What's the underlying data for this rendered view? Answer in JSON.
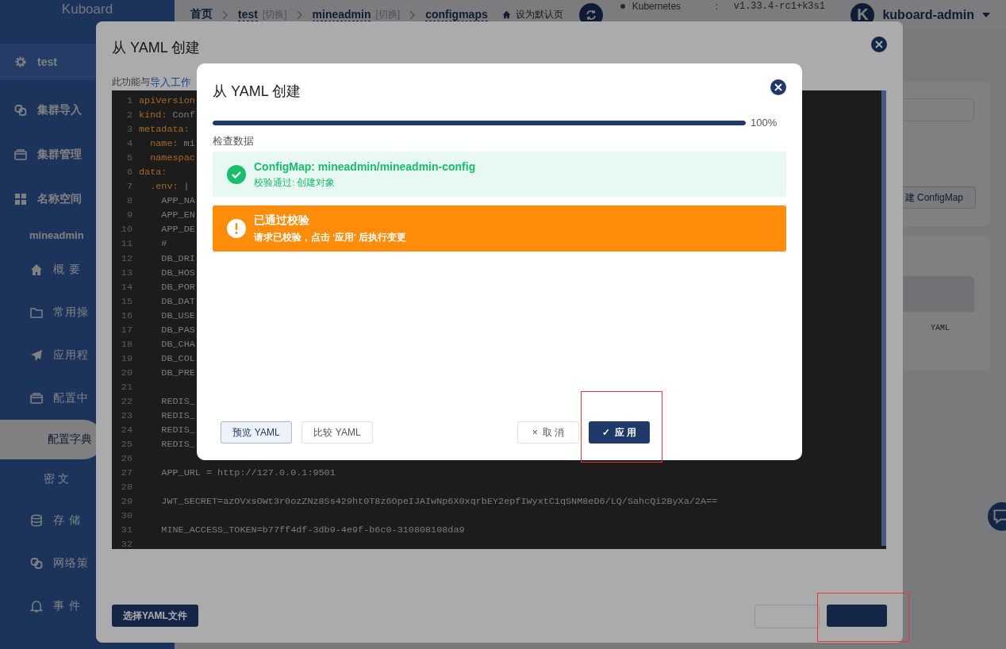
{
  "sidebar": {
    "logo": "Kuboard",
    "items": [
      {
        "label": "test",
        "kind": "cluster",
        "selected": false
      },
      {
        "label": "集群导入",
        "kind": "section",
        "selected": false
      },
      {
        "label": "集群管理",
        "kind": "section",
        "selected": false
      },
      {
        "label": "名称空间",
        "kind": "section",
        "selected": false
      },
      {
        "label": "mineadmin",
        "kind": "namespace",
        "selected": false
      },
      {
        "label": "概 要",
        "kind": "item",
        "selected": false
      },
      {
        "label": "常用操",
        "kind": "item",
        "selected": false
      },
      {
        "label": "应用程",
        "kind": "item",
        "selected": false
      },
      {
        "label": "配置中",
        "kind": "item",
        "selected": false
      },
      {
        "label": "配置字典",
        "kind": "sub",
        "selected": true
      },
      {
        "label": "密 文",
        "kind": "sub",
        "selected": false
      },
      {
        "label": "存 储",
        "kind": "item",
        "selected": false
      },
      {
        "label": "网络策",
        "kind": "item",
        "selected": false
      },
      {
        "label": "事 件",
        "kind": "item",
        "selected": false
      }
    ]
  },
  "header": {
    "breadcrumbs": [
      {
        "label": "首页"
      },
      {
        "label": "test",
        "switch": "[切换]"
      },
      {
        "label": "mineadmin",
        "switch": "[切换]"
      },
      {
        "label": "configmaps"
      }
    ],
    "set_default": "设为默认页",
    "version": {
      "name": "Kubernetes",
      "separator": ":",
      "value": "v1.33.4-rc1+k3s1"
    },
    "user": {
      "avatar": "K",
      "name": "kuboard-admin"
    }
  },
  "content": {
    "create_button": "建 ConfigMap",
    "table_text": "YAML"
  },
  "outer_dialog": {
    "title": "从 YAML 创建",
    "note": "此功能与",
    "note_link": "导入工作",
    "choose_file_button": "选择YAML文件",
    "editor_lines": [
      {
        "n": "1",
        "key": "apiVersion"
      },
      {
        "n": "2",
        "key": "kind:",
        "value": "Conf"
      },
      {
        "n": "3",
        "key": "metadata:"
      },
      {
        "n": "4",
        "key": "  name:",
        "value": "mi"
      },
      {
        "n": "5",
        "key": "  namespac"
      },
      {
        "n": "6",
        "key": "data:"
      },
      {
        "n": "7",
        "key": "  .env:",
        "value": "|"
      },
      {
        "n": "8",
        "value": "    APP_NA"
      },
      {
        "n": "9",
        "value": "    APP_EN"
      },
      {
        "n": "10",
        "value": "    APP_DE"
      },
      {
        "n": "11",
        "value": "    #"
      },
      {
        "n": "12",
        "value": "    DB_DRI"
      },
      {
        "n": "13",
        "value": "    DB_HOS"
      },
      {
        "n": "14",
        "value": "    DB_POR"
      },
      {
        "n": "15",
        "value": "    DB_DAT"
      },
      {
        "n": "16",
        "value": "    DB_USE"
      },
      {
        "n": "17",
        "value": "    DB_PAS"
      },
      {
        "n": "18",
        "value": "    DB_CHA"
      },
      {
        "n": "19",
        "value": "    DB_COL"
      },
      {
        "n": "20",
        "value": "    DB_PRE"
      },
      {
        "n": "21"
      },
      {
        "n": "22",
        "value": "    REDIS_"
      },
      {
        "n": "23",
        "value": "    REDIS_"
      },
      {
        "n": "24",
        "value": "    REDIS_"
      },
      {
        "n": "25",
        "value": "    REDIS_"
      },
      {
        "n": "26"
      },
      {
        "n": "27",
        "value": "    APP_URL = http://127.0.0.1:9501"
      },
      {
        "n": "28"
      },
      {
        "n": "29",
        "value": "    JWT_SECRET=azOVxsOWt3r0ozZNz8Ss429ht0T8z6OpeIJAIwNp6X0xqrbEY2epfIWyxtC1qSNM8eD6/LQ/SahcQi2ByXa/2A=="
      },
      {
        "n": "30"
      },
      {
        "n": "31",
        "value": "    MINE_ACCESS_TOKEN=b77ff4df-3db9-4e9f-b6c0-310808108da9"
      },
      {
        "n": "32"
      }
    ]
  },
  "inner_dialog": {
    "title": "从 YAML 创建",
    "progress": {
      "level": 1,
      "reading": "100%"
    },
    "section": "检查数据",
    "results": [
      {
        "kind": "success",
        "title": "ConfigMap: mineadmin/mineadmin-config",
        "message": "校验通过: 创建对象"
      },
      {
        "kind": "warning",
        "title": "已通过校验",
        "message": "请求已校验，点击 '应用' 后执行变更"
      }
    ],
    "yaml_buttons": [
      {
        "label": "预览 YAML",
        "selected": true
      },
      {
        "label": "比较 YAML",
        "selected": false
      }
    ],
    "cancel": {
      "icon": "×",
      "label": "取 消"
    },
    "apply": {
      "icon": "✓",
      "label": "应 用"
    }
  }
}
